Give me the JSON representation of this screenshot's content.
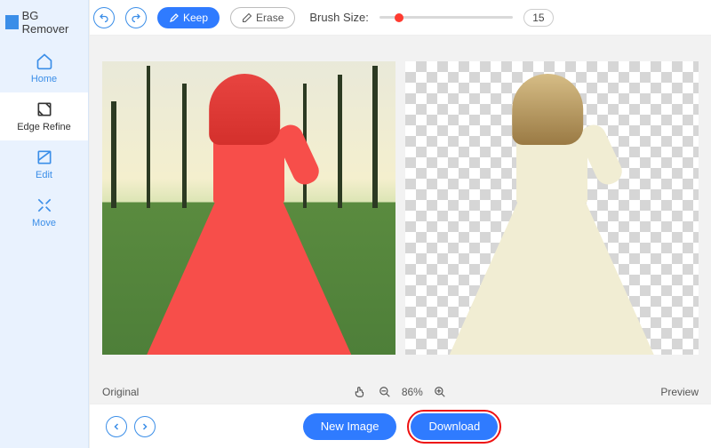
{
  "app": {
    "title": "BG Remover"
  },
  "sidebar": {
    "items": [
      {
        "label": "Home",
        "name": "home"
      },
      {
        "label": "Edge Refine",
        "name": "edge-refine"
      },
      {
        "label": "Edit",
        "name": "edit"
      },
      {
        "label": "Move",
        "name": "move"
      }
    ],
    "active_index": 1
  },
  "toolbar": {
    "keep_label": "Keep",
    "erase_label": "Erase",
    "brush_size_label": "Brush Size:",
    "brush_size_value": "15",
    "brush_size_percent": 15
  },
  "status": {
    "original_label": "Original",
    "preview_label": "Preview",
    "zoom_label": "86%"
  },
  "footer": {
    "new_image_label": "New Image",
    "download_label": "Download"
  }
}
